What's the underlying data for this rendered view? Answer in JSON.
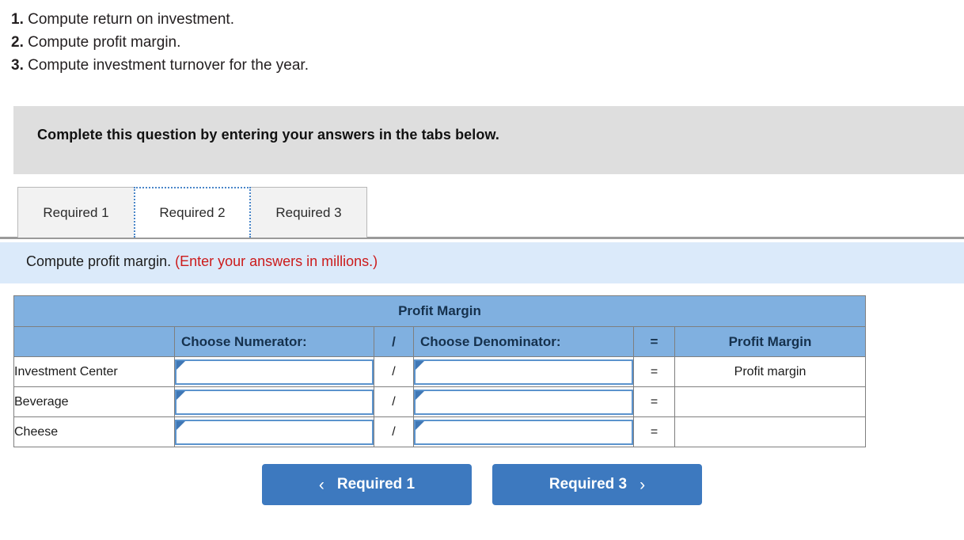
{
  "requirements": [
    {
      "num": "1.",
      "text": "Compute return on investment."
    },
    {
      "num": "2.",
      "text": "Compute profit margin."
    },
    {
      "num": "3.",
      "text": "Compute investment turnover for the year."
    }
  ],
  "banner": {
    "text": "Complete this question by entering your answers in the tabs below."
  },
  "tabs": [
    {
      "label": "Required 1",
      "active": false
    },
    {
      "label": "Required 2",
      "active": true
    },
    {
      "label": "Required 3",
      "active": false
    }
  ],
  "instruction": {
    "black": "Compute profit margin.",
    "red": "(Enter your answers in millions.)"
  },
  "table": {
    "title": "Profit Margin",
    "headers": {
      "blank": "",
      "numerator": "Choose Numerator:",
      "slash": "/",
      "denominator": "Choose Denominator:",
      "equals": "=",
      "result": "Profit Margin"
    },
    "rows": [
      {
        "label": "Investment Center",
        "numerator": "",
        "slash": "/",
        "denominator": "",
        "equals": "=",
        "result": "Profit margin"
      },
      {
        "label": "Beverage",
        "numerator": "",
        "slash": "/",
        "denominator": "",
        "equals": "=",
        "result": ""
      },
      {
        "label": "Cheese",
        "numerator": "",
        "slash": "/",
        "denominator": "",
        "equals": "=",
        "result": ""
      }
    ]
  },
  "nav": {
    "prev_label": "Required 1",
    "prev_icon": "chevron-left",
    "next_label": "Required 3",
    "next_icon": "chevron-right"
  },
  "colors": {
    "header_blue": "#80b0e0",
    "button_blue": "#3d79bf",
    "strip_blue": "#dbeafa",
    "banner_gray": "#dedede",
    "accent_red": "#cc1b1b",
    "input_border": "#5b93cd"
  }
}
